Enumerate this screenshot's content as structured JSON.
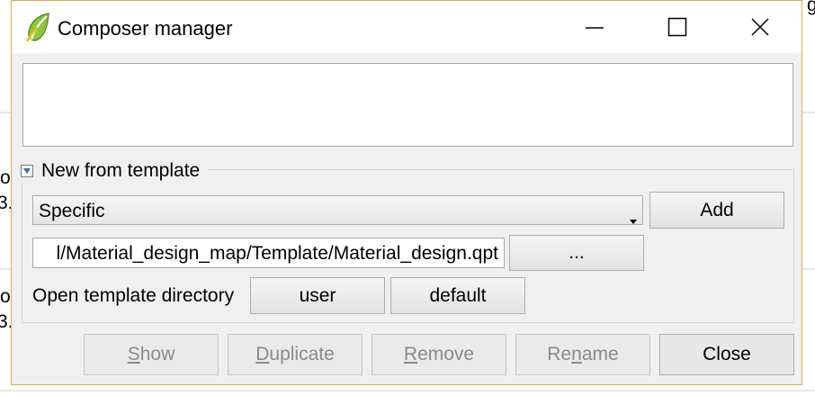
{
  "background": {
    "fragments": [
      "o",
      "3.",
      "o",
      "3.",
      "g"
    ]
  },
  "window": {
    "title": "Composer manager",
    "icon": "qgis-icon",
    "controls": [
      "minimize-icon",
      "maximize-icon",
      "close-icon"
    ]
  },
  "composer_list": {
    "items": []
  },
  "template_group": {
    "label": "New from template",
    "expanded": true,
    "template_type": {
      "selected": "Specific"
    },
    "add_label": "Add",
    "path_value": "l/Material_design_map/Template/Material_design.qpt",
    "browse_label": "...",
    "dir_label": "Open template directory",
    "user_label": "user",
    "default_label": "default"
  },
  "footer": {
    "show": {
      "pre": "",
      "mn": "S",
      "post": "how"
    },
    "duplicate": {
      "pre": "",
      "mn": "D",
      "post": "uplicate"
    },
    "remove": {
      "pre": "",
      "mn": "R",
      "post": "emove"
    },
    "rename": {
      "pre": "Re",
      "mn": "n",
      "post": "ame"
    },
    "close_label": "Close"
  },
  "colors": {
    "window_border": "#e3a85a",
    "dialog_bg": "#f0f0f0",
    "disabled_text": "#8a8a8a"
  }
}
